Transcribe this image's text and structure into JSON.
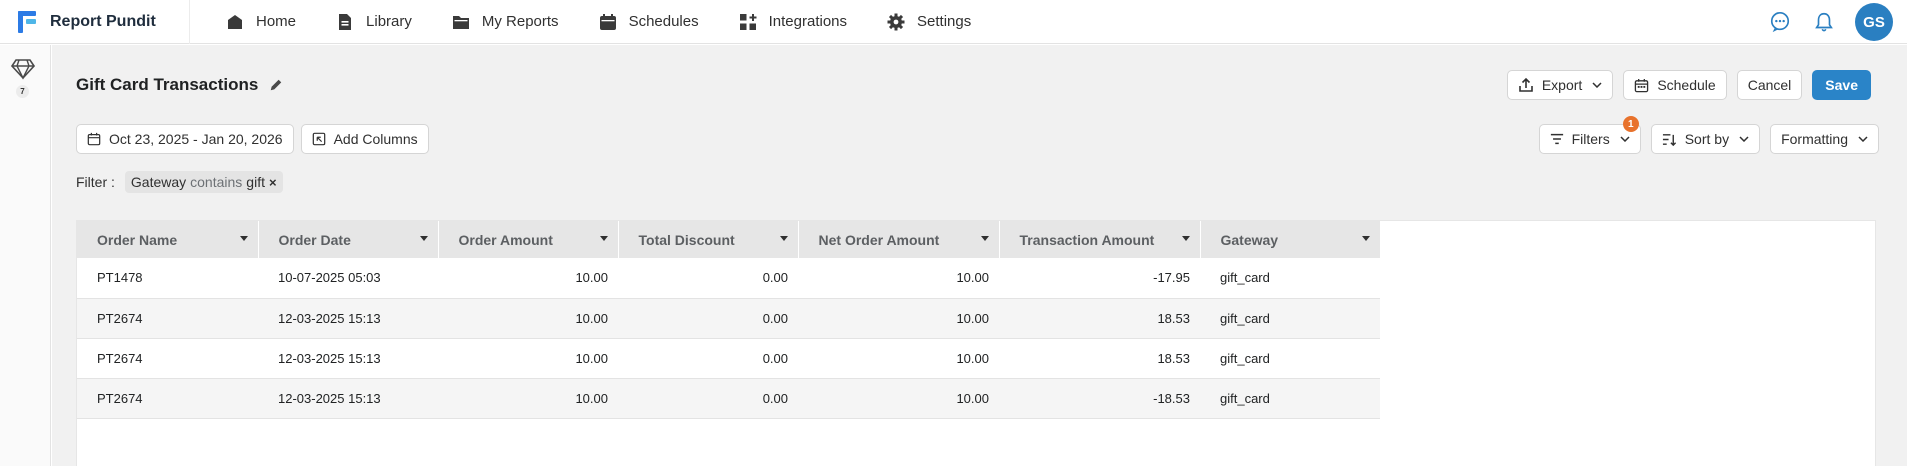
{
  "app": {
    "name": "Report Pundit"
  },
  "nav": {
    "items": [
      {
        "label": "Home",
        "icon": "home-icon"
      },
      {
        "label": "Library",
        "icon": "document-icon"
      },
      {
        "label": "My Reports",
        "icon": "folder-icon"
      },
      {
        "label": "Schedules",
        "icon": "calendar-icon"
      },
      {
        "label": "Integrations",
        "icon": "integrations-icon"
      },
      {
        "label": "Settings",
        "icon": "gear-icon"
      }
    ]
  },
  "user": {
    "initials": "GS"
  },
  "rail": {
    "badge": "7"
  },
  "report": {
    "title": "Gift Card Transactions",
    "date_range": "Oct 23, 2025 - Jan 20, 2026",
    "add_columns": "Add Columns"
  },
  "actions": {
    "export": "Export",
    "schedule": "Schedule",
    "cancel": "Cancel",
    "save": "Save"
  },
  "tools": {
    "filters": "Filters",
    "filters_count": "1",
    "sort_by": "Sort by",
    "formatting": "Formatting"
  },
  "filter": {
    "label": "Filter :",
    "field": "Gateway",
    "operator": "contains",
    "value": "gift",
    "remove": "×"
  },
  "table": {
    "columns": [
      "Order Name",
      "Order Date",
      "Order Amount",
      "Total Discount",
      "Net Order Amount",
      "Transaction Amount",
      "Gateway"
    ],
    "rows": [
      [
        "PT1478",
        "10-07-2025 05:03",
        "10.00",
        "0.00",
        "10.00",
        "-17.95",
        "gift_card"
      ],
      [
        "PT2674",
        "12-03-2025 15:13",
        "10.00",
        "0.00",
        "10.00",
        "18.53",
        "gift_card"
      ],
      [
        "PT2674",
        "12-03-2025 15:13",
        "10.00",
        "0.00",
        "10.00",
        "18.53",
        "gift_card"
      ],
      [
        "PT2674",
        "12-03-2025 15:13",
        "10.00",
        "0.00",
        "10.00",
        "-18.53",
        "gift_card"
      ]
    ]
  },
  "colors": {
    "accent": "#2a84c8",
    "badge": "#e8722c",
    "avatar": "#2a7fc1"
  }
}
